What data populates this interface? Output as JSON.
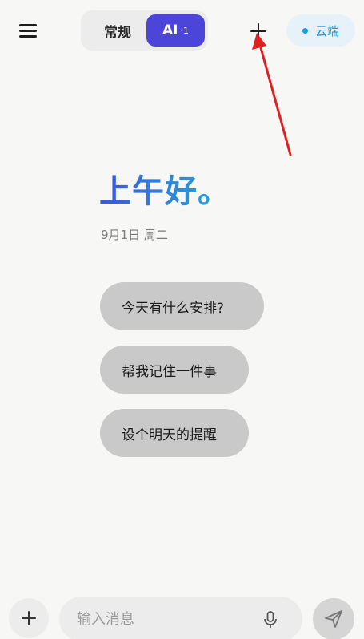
{
  "header": {
    "tabs": [
      {
        "label": "常规",
        "active": false
      },
      {
        "label": "AI",
        "suffix": "·1",
        "active": true
      }
    ],
    "cloud_label": "云端",
    "icons": {
      "menu": "menu-icon",
      "new_chat": "plus-icon",
      "cloud_status": "status-dot"
    }
  },
  "main": {
    "greeting": "上午好。",
    "date": "9月1日 周二",
    "suggestions": [
      "今天有什么安排?",
      "帮我记住一件事",
      "设个明天的提醒"
    ]
  },
  "composer": {
    "placeholder": "输入消息",
    "icons": {
      "attach": "plus-icon",
      "voice": "mic-icon",
      "send": "send-icon"
    }
  },
  "colors": {
    "accent": "#4b45d9",
    "cloud": "#1a9fe0",
    "greeting_start": "#3c57d8",
    "greeting_end": "#22a8de",
    "annotation_arrow": "#e02020"
  }
}
